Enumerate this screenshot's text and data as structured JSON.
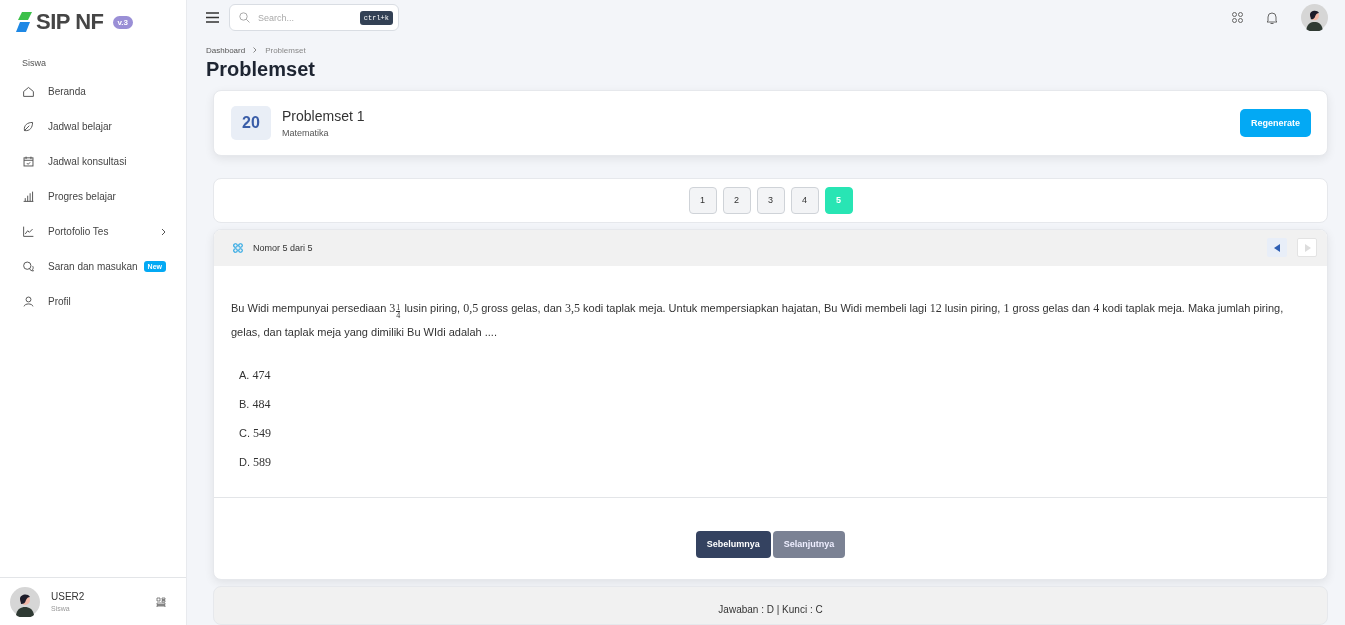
{
  "brand": {
    "name": "SIP NF",
    "version": "v.3"
  },
  "sidebar": {
    "section": "Siswa",
    "items": [
      {
        "label": "Beranda",
        "submenu": false
      },
      {
        "label": "Jadwal belajar",
        "submenu": false
      },
      {
        "label": "Jadwal konsultasi",
        "submenu": false
      },
      {
        "label": "Progres belajar",
        "submenu": false
      },
      {
        "label": "Portofolio Tes",
        "submenu": true
      },
      {
        "label": "Saran dan masukan",
        "submenu": false,
        "badge": "New"
      },
      {
        "label": "Profil",
        "submenu": false
      }
    ]
  },
  "user": {
    "name": "USER2",
    "role": "Siswa"
  },
  "topbar": {
    "search": {
      "placeholder": "Search...",
      "shortcut": "ctrl+k"
    }
  },
  "breadcrumb": [
    "Dashboard",
    "Problemset"
  ],
  "page_title": "Problemset",
  "problemset": {
    "count": "20",
    "title": "Problemset 1",
    "subject": "Matematika",
    "button": "Regenerate"
  },
  "pages": [
    {
      "label": "1",
      "selected": false
    },
    {
      "label": "2",
      "selected": false
    },
    {
      "label": "3",
      "selected": false
    },
    {
      "label": "4",
      "selected": false
    },
    {
      "label": "5",
      "selected": true
    }
  ],
  "question": {
    "header": "Nomor 5 dari 5",
    "prev_disabled": false,
    "next_disabled": true,
    "parts": [
      {
        "kind": "text",
        "text": "Bu Widi mempunyai persediaan "
      },
      {
        "kind": "fraction",
        "whole": "3",
        "numerator": "1",
        "denominator": "4"
      },
      {
        "kind": "text",
        "text": " lusin piring, "
      },
      {
        "kind": "math",
        "text": "0,5"
      },
      {
        "kind": "text",
        "text": " gross gelas, dan "
      },
      {
        "kind": "math",
        "text": "3,5"
      },
      {
        "kind": "text",
        "text": " kodi taplak meja. Untuk mempersiapkan hajatan, Bu Widi membeli lagi "
      },
      {
        "kind": "math",
        "text": "12"
      },
      {
        "kind": "text",
        "text": " lusin piring, "
      },
      {
        "kind": "math",
        "text": "1"
      },
      {
        "kind": "text",
        "text": " gross gelas dan "
      },
      {
        "kind": "math",
        "text": "4"
      },
      {
        "kind": "text",
        "text": " kodi taplak meja. Maka jumlah piring, gelas, dan taplak meja yang dimiliki Bu WIdi adalah ...."
      }
    ],
    "options": [
      {
        "letter": "A.",
        "value": "474"
      },
      {
        "letter": "B.",
        "value": "484"
      },
      {
        "letter": "C.",
        "value": "549"
      },
      {
        "letter": "D.",
        "value": "589"
      }
    ],
    "buttons": [
      {
        "label": "Sebelumnya",
        "disabled": false
      },
      {
        "label": "Selanjutnya",
        "disabled": true
      }
    ]
  },
  "result": "Jawaban : D | Kunci : C"
}
